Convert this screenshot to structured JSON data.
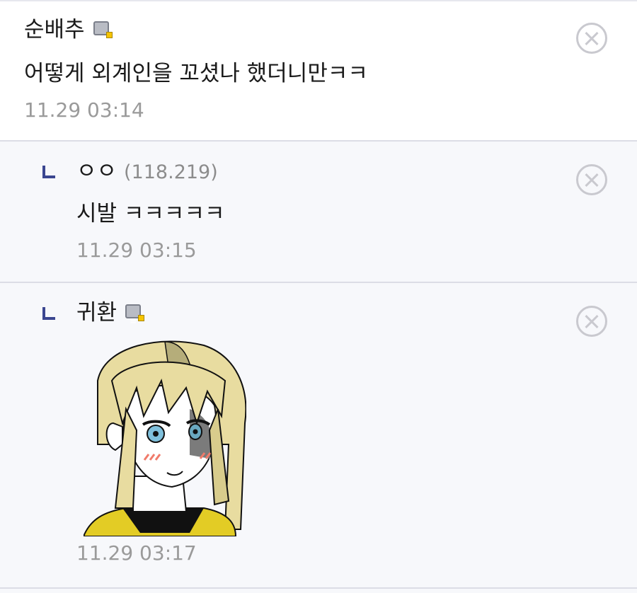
{
  "comments": [
    {
      "author": "순배추",
      "ip": "",
      "message": "어떻게 외계인을 꼬셨나 했더니만ㅋㅋ",
      "time": "11.29 03:14",
      "reply": false,
      "badge_icon": "fixed-nick-badge-icon"
    },
    {
      "author": "ㅇㅇ",
      "ip": "(118.219)",
      "message": "시발 ㅋㅋㅋㅋㅋ",
      "time": "11.29 03:15",
      "reply": true
    },
    {
      "author": "귀환",
      "ip": "",
      "message": "",
      "time": "11.29 03:17",
      "reply": true,
      "badge_icon": "fixed-nick-badge-icon",
      "sticker": "anime-girl-sticker"
    }
  ],
  "colors": {
    "reply_mark": "#3b4690",
    "reply_background": "#f7f8fb",
    "divider": "#dcdde6",
    "timestamp": "#9a9a9a",
    "badge_dot": "#f5c400"
  }
}
